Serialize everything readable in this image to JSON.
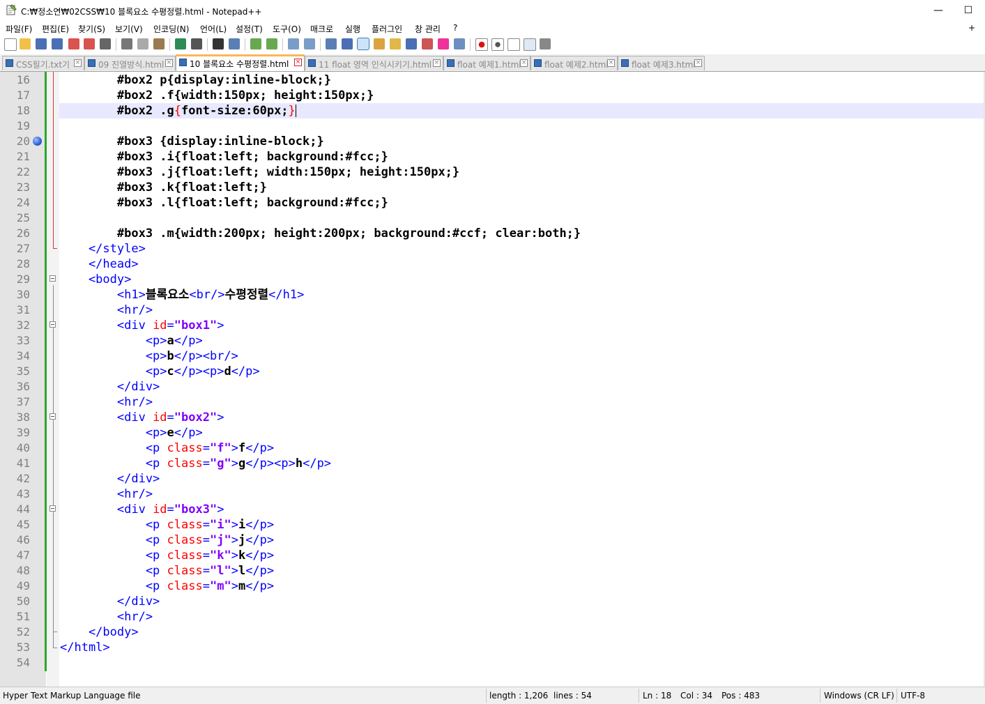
{
  "window": {
    "title": "C:₩정소연₩02CSS₩10 블록요소 수평정렬.html - Notepad++",
    "min_glyph": "—",
    "max_glyph": "☐",
    "close_glyph": "✕"
  },
  "menu": {
    "items": [
      "파일(F)",
      "편집(E)",
      "찾기(S)",
      "보기(V)",
      "인코딩(N)",
      "언어(L)",
      "설정(T)",
      "도구(O)",
      "매크로",
      "실행",
      "플러그인",
      "창 관리",
      "?"
    ],
    "plus": "+"
  },
  "tabs": [
    {
      "label": "CSS필기.txt기",
      "active": false
    },
    {
      "label": "09 진열방식.html",
      "active": false
    },
    {
      "label": "10 블록요소 수평정렬.html",
      "active": true
    },
    {
      "label": "11 float 영역 인식시키기.html",
      "active": false
    },
    {
      "label": "float 예제1.html",
      "active": false
    },
    {
      "label": "float 예제2.html",
      "active": false
    },
    {
      "label": "float 예제3.html",
      "active": false
    }
  ],
  "tab_close_glyph": "×",
  "editor": {
    "line_numbers": [
      "16",
      "17",
      "18",
      "19",
      "20",
      "21",
      "22",
      "23",
      "24",
      "25",
      "26",
      "27",
      "28",
      "29",
      "30",
      "31",
      "32",
      "33",
      "34",
      "35",
      "36",
      "37",
      "38",
      "39",
      "40",
      "41",
      "42",
      "43",
      "44",
      "45",
      "46",
      "47",
      "48",
      "49",
      "50",
      "51",
      "52",
      "53",
      "54"
    ],
    "lines": [
      [
        [
          "css",
          "        #box2 p{display:inline-block;}"
        ]
      ],
      [
        [
          "css",
          "        #box2 .f{width:150px; height:150px;}"
        ]
      ],
      [
        [
          "css",
          "        #box2 .g"
        ],
        [
          "br",
          "{"
        ],
        [
          "css",
          "font-size:60px;"
        ],
        [
          "br",
          "}"
        ]
      ],
      [],
      [
        [
          "css",
          "        #box3 {display:inline-block;}"
        ]
      ],
      [
        [
          "css",
          "        #box3 .i{float:left; background:#fcc;}"
        ]
      ],
      [
        [
          "css",
          "        #box3 .j{float:left; width:150px; height:150px;}"
        ]
      ],
      [
        [
          "css",
          "        #box3 .k{float:left;}"
        ]
      ],
      [
        [
          "css",
          "        #box3 .l{float:left; background:#fcc;}"
        ]
      ],
      [],
      [
        [
          "css",
          "        #box3 .m{width:200px; height:200px; background:#ccf; clear:both;}"
        ]
      ],
      [
        [
          "tag",
          "    </style>"
        ]
      ],
      [
        [
          "tag",
          "    </head>"
        ]
      ],
      [
        [
          "tag",
          "    <body>"
        ]
      ],
      [
        [
          "tag",
          "        <h1>"
        ],
        [
          "txt",
          "블록요소"
        ],
        [
          "tag",
          "<br/>"
        ],
        [
          "txt",
          "수평정렬"
        ],
        [
          "tag",
          "</h1>"
        ]
      ],
      [
        [
          "tag",
          "        <hr/>"
        ]
      ],
      [
        [
          "tag",
          "        <div "
        ],
        [
          "attr",
          "id"
        ],
        [
          "tag",
          "="
        ],
        [
          "val",
          "\"box1\""
        ],
        [
          "tag",
          ">"
        ]
      ],
      [
        [
          "tag",
          "            <p>"
        ],
        [
          "txt",
          "a"
        ],
        [
          "tag",
          "</p>"
        ]
      ],
      [
        [
          "tag",
          "            <p>"
        ],
        [
          "txt",
          "b"
        ],
        [
          "tag",
          "</p><br/>"
        ]
      ],
      [
        [
          "tag",
          "            <p>"
        ],
        [
          "txt",
          "c"
        ],
        [
          "tag",
          "</p><p>"
        ],
        [
          "txt",
          "d"
        ],
        [
          "tag",
          "</p>"
        ]
      ],
      [
        [
          "tag",
          "        </div>"
        ]
      ],
      [
        [
          "tag",
          "        <hr/>"
        ]
      ],
      [
        [
          "tag",
          "        <div "
        ],
        [
          "attr",
          "id"
        ],
        [
          "tag",
          "="
        ],
        [
          "val",
          "\"box2\""
        ],
        [
          "tag",
          ">"
        ]
      ],
      [
        [
          "tag",
          "            <p>"
        ],
        [
          "txt",
          "e"
        ],
        [
          "tag",
          "</p>"
        ]
      ],
      [
        [
          "tag",
          "            <p "
        ],
        [
          "attr",
          "class"
        ],
        [
          "tag",
          "="
        ],
        [
          "val",
          "\"f\""
        ],
        [
          "tag",
          ">"
        ],
        [
          "txt",
          "f"
        ],
        [
          "tag",
          "</p>"
        ]
      ],
      [
        [
          "tag",
          "            <p "
        ],
        [
          "attr",
          "class"
        ],
        [
          "tag",
          "="
        ],
        [
          "val",
          "\"g\""
        ],
        [
          "tag",
          ">"
        ],
        [
          "txt",
          "g"
        ],
        [
          "tag",
          "</p><p>"
        ],
        [
          "txt",
          "h"
        ],
        [
          "tag",
          "</p>"
        ]
      ],
      [
        [
          "tag",
          "        </div>"
        ]
      ],
      [
        [
          "tag",
          "        <hr/>"
        ]
      ],
      [
        [
          "tag",
          "        <div "
        ],
        [
          "attr",
          "id"
        ],
        [
          "tag",
          "="
        ],
        [
          "val",
          "\"box3\""
        ],
        [
          "tag",
          ">"
        ]
      ],
      [
        [
          "tag",
          "            <p "
        ],
        [
          "attr",
          "class"
        ],
        [
          "tag",
          "="
        ],
        [
          "val",
          "\"i\""
        ],
        [
          "tag",
          ">"
        ],
        [
          "txt",
          "i"
        ],
        [
          "tag",
          "</p>"
        ]
      ],
      [
        [
          "tag",
          "            <p "
        ],
        [
          "attr",
          "class"
        ],
        [
          "tag",
          "="
        ],
        [
          "val",
          "\"j\""
        ],
        [
          "tag",
          ">"
        ],
        [
          "txt",
          "j"
        ],
        [
          "tag",
          "</p>"
        ]
      ],
      [
        [
          "tag",
          "            <p "
        ],
        [
          "attr",
          "class"
        ],
        [
          "tag",
          "="
        ],
        [
          "val",
          "\"k\""
        ],
        [
          "tag",
          ">"
        ],
        [
          "txt",
          "k"
        ],
        [
          "tag",
          "</p>"
        ]
      ],
      [
        [
          "tag",
          "            <p "
        ],
        [
          "attr",
          "class"
        ],
        [
          "tag",
          "="
        ],
        [
          "val",
          "\"l\""
        ],
        [
          "tag",
          ">"
        ],
        [
          "txt",
          "l"
        ],
        [
          "tag",
          "</p>"
        ]
      ],
      [
        [
          "tag",
          "            <p "
        ],
        [
          "attr",
          "class"
        ],
        [
          "tag",
          "="
        ],
        [
          "val",
          "\"m\""
        ],
        [
          "tag",
          ">"
        ],
        [
          "txt",
          "m"
        ],
        [
          "tag",
          "</p>"
        ]
      ],
      [
        [
          "tag",
          "        </div>"
        ]
      ],
      [
        [
          "tag",
          "        <hr/>"
        ]
      ],
      [
        [
          "tag",
          "    </body>"
        ]
      ],
      [
        [
          "tag",
          "</html>"
        ]
      ],
      []
    ],
    "current_line": "18",
    "bookmark_line": "20"
  },
  "status": {
    "filetype": "Hyper Text Markup Language file",
    "length": "length : 1,206",
    "lines": "lines : 54",
    "ln": "Ln : 18",
    "col": "Col : 34",
    "pos": "Pos : 483",
    "eol": "Windows (CR LF)",
    "encoding": "UTF-8"
  },
  "colors": {
    "tag": "#0000ff",
    "attr": "#ff0000",
    "value": "#8000ff",
    "active_tab_accent": "#fab65a",
    "caret_line": "#e8e8ff",
    "change_bar": "#2aa82a"
  }
}
